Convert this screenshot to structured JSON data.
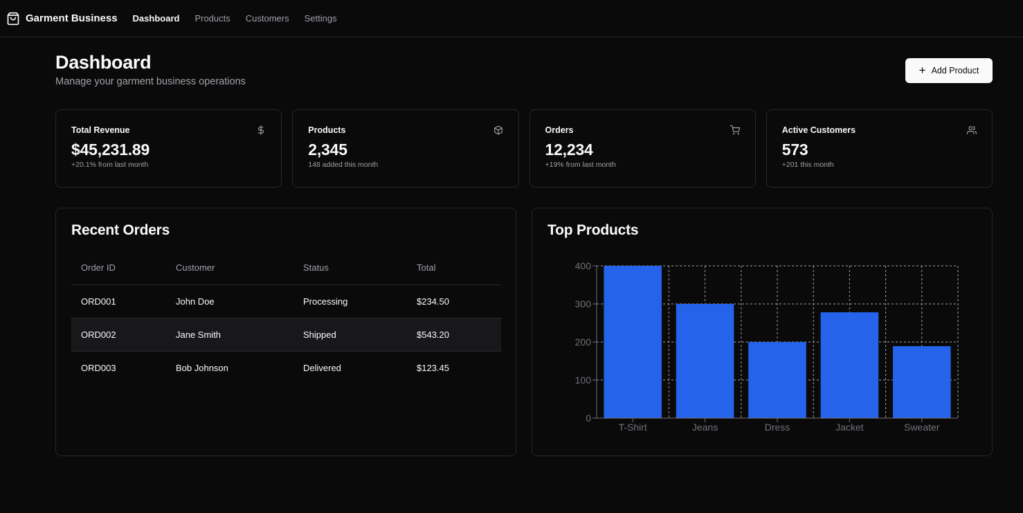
{
  "app": {
    "title": "Garment Business",
    "logo_icon": "shopping-bag-icon"
  },
  "nav": [
    {
      "label": "Dashboard",
      "active": true
    },
    {
      "label": "Products",
      "active": false
    },
    {
      "label": "Customers",
      "active": false
    },
    {
      "label": "Settings",
      "active": false
    }
  ],
  "header": {
    "title": "Dashboard",
    "subtitle": "Manage your garment business operations",
    "add_button": "Add Product"
  },
  "stats": [
    {
      "title": "Total Revenue",
      "value": "$45,231.89",
      "note": "+20.1% from last month",
      "icon": "dollar-icon"
    },
    {
      "title": "Products",
      "value": "2,345",
      "note": "148 added this month",
      "icon": "package-icon"
    },
    {
      "title": "Orders",
      "value": "12,234",
      "note": "+19% from last month",
      "icon": "cart-icon"
    },
    {
      "title": "Active Customers",
      "value": "573",
      "note": "+201 this month",
      "icon": "users-icon"
    }
  ],
  "orders": {
    "title": "Recent Orders",
    "columns": [
      "Order ID",
      "Customer",
      "Status",
      "Total"
    ],
    "rows": [
      [
        "ORD001",
        "John Doe",
        "Processing",
        "$234.50"
      ],
      [
        "ORD002",
        "Jane Smith",
        "Shipped",
        "$543.20"
      ],
      [
        "ORD003",
        "Bob Johnson",
        "Delivered",
        "$123.45"
      ]
    ]
  },
  "top_products": {
    "title": "Top Products"
  },
  "chart_data": {
    "type": "bar",
    "title": "Top Products",
    "categories": [
      "T-Shirt",
      "Jeans",
      "Dress",
      "Jacket",
      "Sweater"
    ],
    "values": [
      400,
      300,
      200,
      278,
      189
    ],
    "ylim": [
      0,
      400
    ],
    "yticks": [
      0,
      100,
      200,
      300,
      400
    ],
    "grid": true,
    "color": "#2563eb"
  },
  "colors": {
    "background": "#0a0a0a",
    "border": "#27272a",
    "muted": "#a1a1aa",
    "bar": "#2563eb"
  }
}
